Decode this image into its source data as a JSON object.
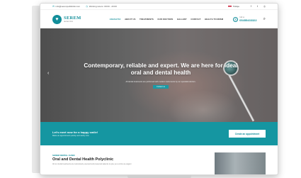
{
  "topbar": {
    "email": "info@serempolikliniki.com",
    "hours": "Working Hours: 09:00 - 20:00",
    "language": "Türkçe",
    "social_icons": [
      "facebook-icon",
      "twitter-icon",
      "instagram-icon"
    ]
  },
  "brand": {
    "name": "SEREM",
    "tagline": "dental clinic",
    "accent": "#128e9a",
    "band_color": "#1596a1"
  },
  "nav": {
    "items": [
      "ANASAYFA",
      "ABOUT US",
      "TREATMENTS",
      "OUR DOCTORS",
      "GALLERY",
      "CONTACT",
      "HEALTH TOURISM"
    ],
    "active_index": 0
  },
  "call": {
    "label": "Call us",
    "number": "05455433322"
  },
  "hero": {
    "title": "Contemporary, reliable and expert. We are here for ideal oral and dental health",
    "subtitle": "All dental treatments are performed with modern instruments by our specialist doctors.",
    "button": "Contact us"
  },
  "cta": {
    "title": "Let's meet now for a happy smile!",
    "subtitle": "Make an appointment quickly and easily now.",
    "button": "Create an appointment"
  },
  "about": {
    "kicker": "SEREM DENTAL CLINIC",
    "title": "Oral and Dental Health Polyclinic",
    "description": "All our dental treatments are meticulously executed and presented patients to give you a smile as elegant"
  }
}
